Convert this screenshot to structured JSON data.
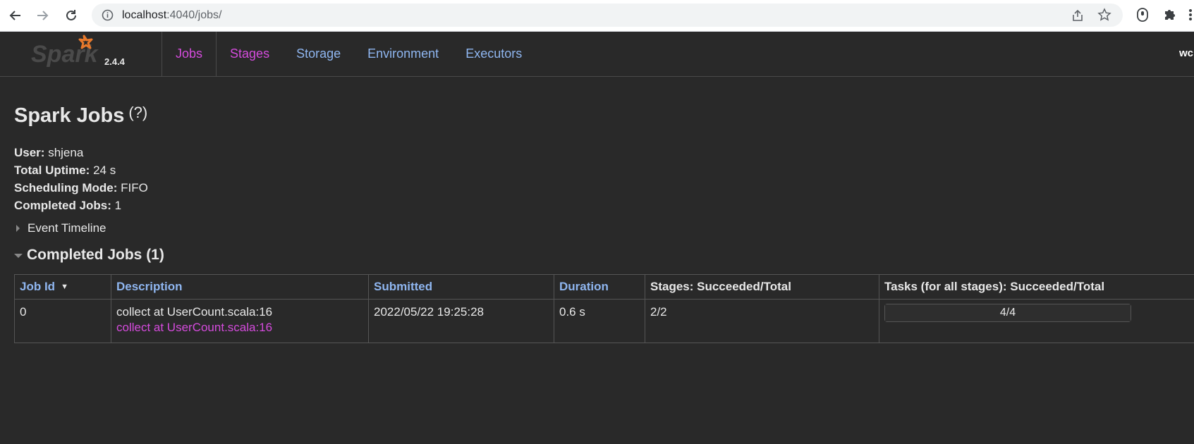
{
  "browser": {
    "url_host": "localhost",
    "url_rest": ":4040/jobs/"
  },
  "navbar": {
    "version": "2.4.4",
    "tabs": [
      {
        "label": "Jobs"
      },
      {
        "label": "Stages"
      },
      {
        "label": "Storage"
      },
      {
        "label": "Environment"
      },
      {
        "label": "Executors"
      }
    ],
    "app_name": "wc"
  },
  "page": {
    "title": "Spark Jobs",
    "help": "(?)",
    "summary": {
      "user_label": "User:",
      "user_value": "shjena",
      "uptime_label": "Total Uptime:",
      "uptime_value": "24 s",
      "mode_label": "Scheduling Mode:",
      "mode_value": "FIFO",
      "completed_label": "Completed Jobs:",
      "completed_value": "1"
    },
    "event_timeline": "Event Timeline",
    "completed_section": "Completed Jobs (1)"
  },
  "table": {
    "headers": {
      "job_id": "Job Id",
      "description": "Description",
      "submitted": "Submitted",
      "duration": "Duration",
      "stages": "Stages: Succeeded/Total",
      "tasks": "Tasks (for all stages): Succeeded/Total"
    },
    "rows": [
      {
        "job_id": "0",
        "description": "collect at UserCount.scala:16",
        "description_link": "collect at UserCount.scala:16",
        "submitted": "2022/05/22 19:25:28",
        "duration": "0.6 s",
        "stages": "2/2",
        "tasks": "4/4",
        "tasks_progress": 1.0
      }
    ]
  },
  "colors": {
    "background": "#292929",
    "link_blue": "#8fb6f0",
    "link_magenta": "#d44bdc"
  }
}
